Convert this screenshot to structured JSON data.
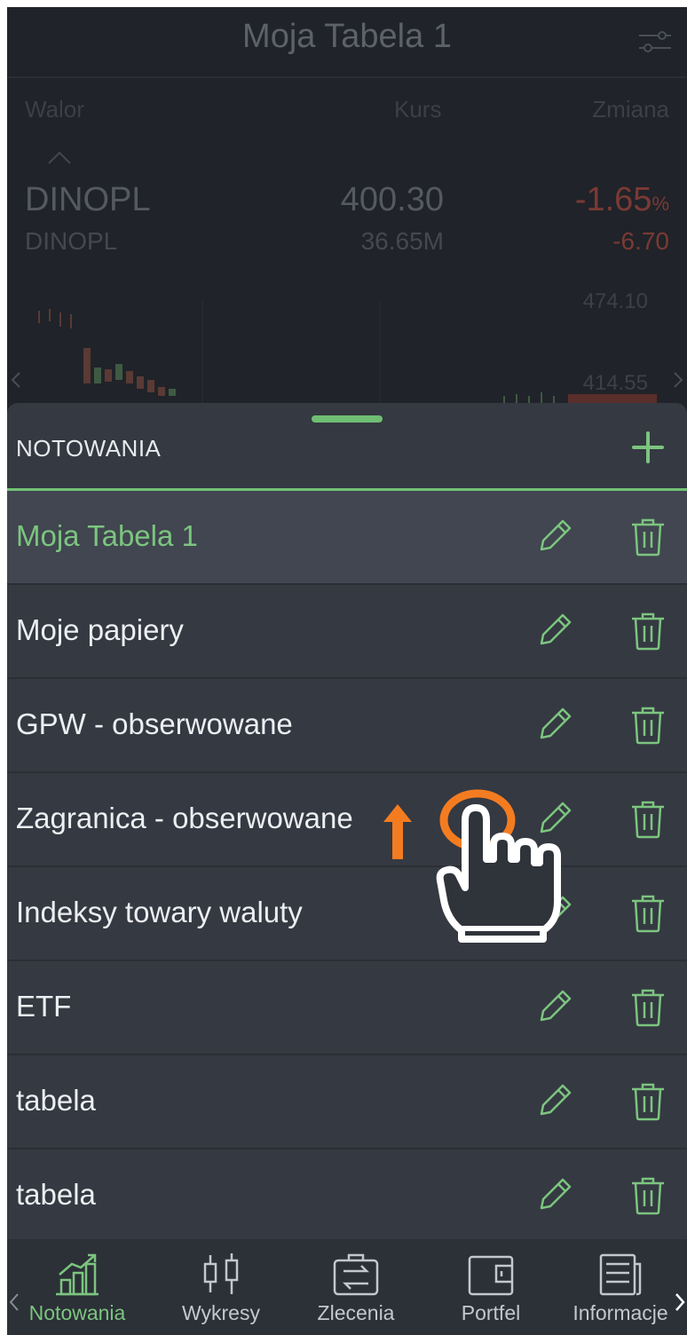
{
  "background_view": {
    "title": "Moja Tabela 1",
    "columns": {
      "walor": "Walor",
      "kurs": "Kurs",
      "zmiana": "Zmiana"
    },
    "instrument": {
      "symbol": "DINOPL",
      "symbol_sub": "DINOPL",
      "price": "400.30",
      "volume": "36.65M",
      "change_pct": "-1.65",
      "change_unit": "%",
      "change_abs": "-6.70"
    },
    "chart_high": "474.10",
    "chart_low": "414.55"
  },
  "sheet": {
    "title": "NOTOWANIA",
    "items": [
      {
        "label": "Moja Tabela 1",
        "active": true
      },
      {
        "label": "Moje papiery"
      },
      {
        "label": "GPW - obserwowane"
      },
      {
        "label": "Zagranica - obserwowane"
      },
      {
        "label": "Indeksy towary waluty"
      },
      {
        "label": "ETF"
      },
      {
        "label": "tabela"
      },
      {
        "label": "tabela"
      }
    ]
  },
  "bottom_nav": {
    "items": [
      {
        "label": "Notowania",
        "icon": "bar-chart-icon",
        "active": true
      },
      {
        "label": "Wykresy",
        "icon": "candlestick-icon"
      },
      {
        "label": "Zlecenia",
        "icon": "transfer-icon"
      },
      {
        "label": "Portfel",
        "icon": "wallet-icon"
      },
      {
        "label": "Informacje",
        "icon": "news-icon"
      }
    ]
  },
  "colors": {
    "accent": "#7cc57f",
    "sheet_bg": "#353942",
    "active_row_bg": "#414650",
    "gesture_orange": "#f47c20"
  }
}
